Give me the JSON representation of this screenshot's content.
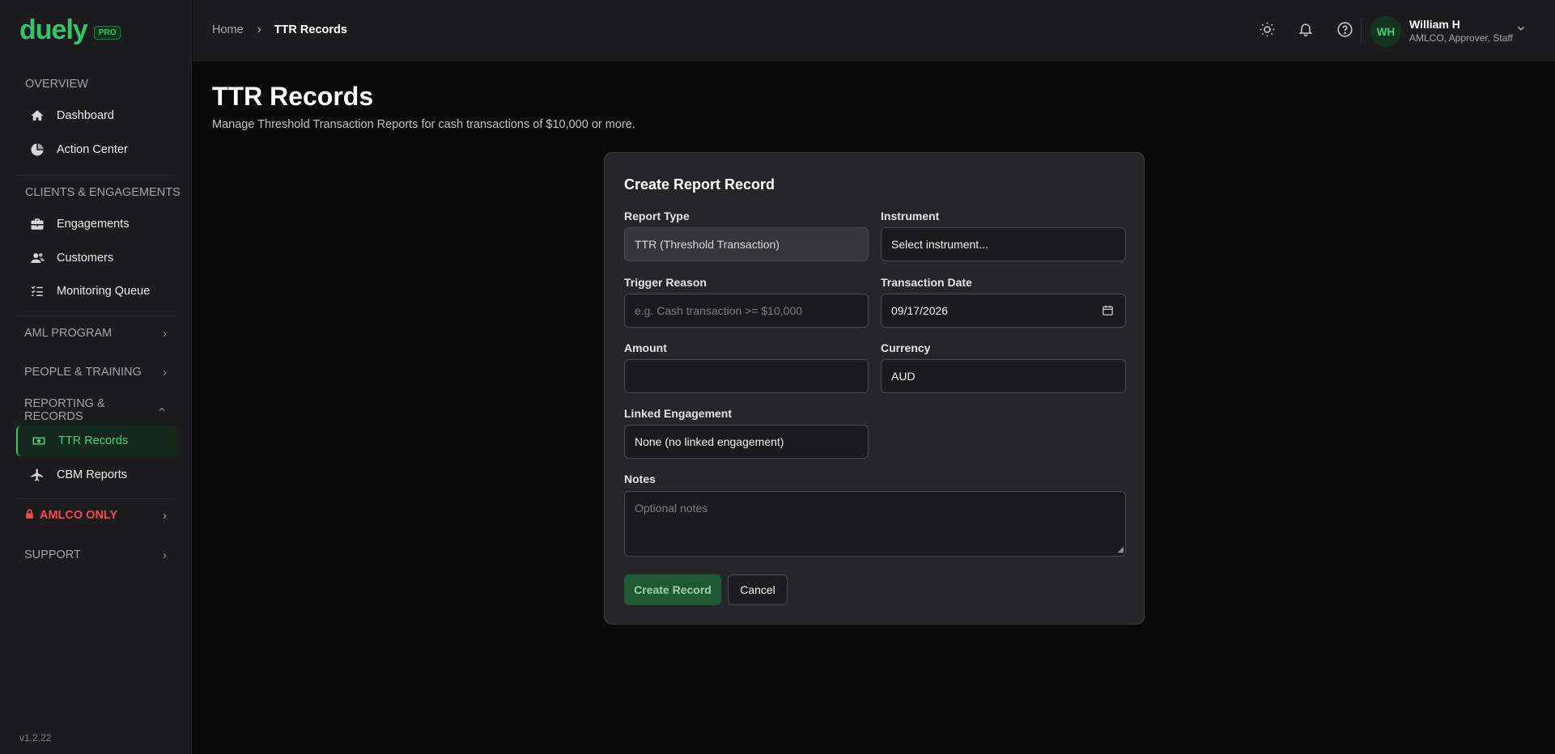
{
  "brand": {
    "name": "duely",
    "badge": "PRO"
  },
  "sidebar": {
    "overview_label": "OVERVIEW",
    "overview_items": [
      {
        "label": "Dashboard",
        "icon": "home-icon"
      },
      {
        "label": "Action Center",
        "icon": "pie-chart-icon"
      }
    ],
    "clients_label": "CLIENTS & ENGAGEMENTS",
    "clients_items": [
      {
        "label": "Engagements",
        "icon": "briefcase-icon"
      },
      {
        "label": "Customers",
        "icon": "users-icon"
      },
      {
        "label": "Monitoring Queue",
        "icon": "list-check-icon"
      }
    ],
    "sections": [
      {
        "label": "AML PROGRAM"
      },
      {
        "label": "PEOPLE & TRAINING"
      },
      {
        "label": "REPORTING & RECORDS"
      },
      {
        "label": "AMLCO ONLY"
      },
      {
        "label": "SUPPORT"
      }
    ],
    "reporting_items": [
      {
        "label": "TTR Records",
        "icon": "money-icon",
        "active": true
      },
      {
        "label": "CBM Reports",
        "icon": "plane-icon"
      }
    ],
    "version": "v1.2.22"
  },
  "topbar": {
    "breadcrumb_home": "Home",
    "breadcrumb_current": "TTR Records",
    "user_initials": "WH",
    "user_name": "William H",
    "user_roles": "AMLCO, Approver, Staff"
  },
  "page": {
    "title": "TTR Records",
    "subtitle": "Manage Threshold Transaction Reports for cash transactions of $10,000 or more."
  },
  "form": {
    "title": "Create Report Record",
    "report_type_label": "Report Type",
    "report_type_value": "TTR (Threshold Transaction)",
    "instrument_label": "Instrument",
    "instrument_value": "Select instrument...",
    "trigger_label": "Trigger Reason",
    "trigger_placeholder": "e.g. Cash transaction >= $10,000",
    "date_label": "Transaction Date",
    "date_value": "09/17/2026",
    "amount_label": "Amount",
    "amount_value": "",
    "currency_label": "Currency",
    "currency_value": "AUD",
    "linked_label": "Linked Engagement",
    "linked_value": "None (no linked engagement)",
    "notes_label": "Notes",
    "notes_placeholder": "Optional notes",
    "create_label": "Create Record",
    "cancel_label": "Cancel"
  },
  "colors": {
    "accent": "#34c46a",
    "danger": "#f04d4d",
    "background": "#0a0a0b",
    "panel": "#1c1c1e"
  }
}
